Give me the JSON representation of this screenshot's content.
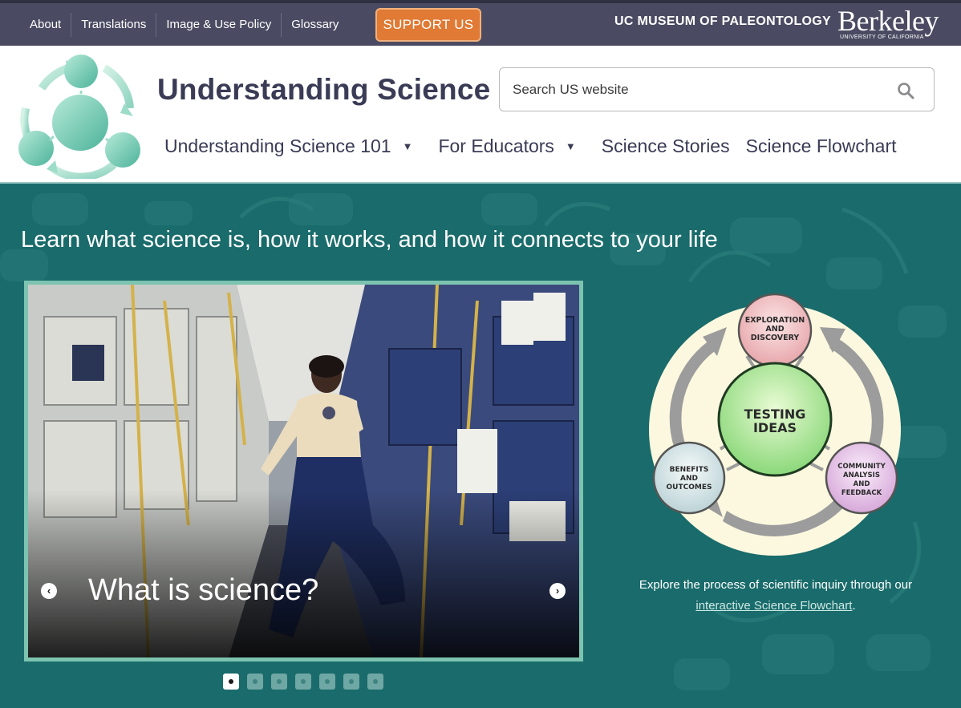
{
  "topbar": {
    "links": [
      "About",
      "Translations",
      "Image & Use Policy",
      "Glossary"
    ],
    "support_label": "SUPPORT US",
    "museum_label": "UC MUSEUM OF PALEONTOLOGY",
    "berkeley_word": "Berkeley",
    "berkeley_sub": "UNIVERSITY OF CALIFORNIA"
  },
  "header": {
    "site_title": "Understanding Science",
    "search_placeholder": "Search US website",
    "nav": [
      {
        "label": "Understanding Science 101",
        "has_dropdown": true
      },
      {
        "label": "For Educators",
        "has_dropdown": true
      },
      {
        "label": "Science Stories",
        "has_dropdown": false
      },
      {
        "label": "Science Flowchart",
        "has_dropdown": false
      }
    ]
  },
  "hero": {
    "tagline": "Learn what science is, how it works, and how it connects to your life",
    "slide_caption": "What is science?",
    "slide_count": 7,
    "active_slide": 1,
    "flowchart": {
      "top": "EXPLORATION AND DISCOVERY",
      "center": "TESTING IDEAS",
      "left": "BENEFITS AND OUTCOMES",
      "right": "COMMUNITY ANALYSIS AND FEEDBACK"
    },
    "flowchart_text_pre": "Explore the process of scientific inquiry through our ",
    "flowchart_link": "interactive Science Flowchart",
    "flowchart_text_post": "."
  },
  "colors": {
    "topbar": "#4a4b62",
    "support": "#e07a34",
    "hero_bg": "#1a6b6b",
    "title_text": "#3a3b55",
    "slider_border": "#7cc4b0"
  }
}
